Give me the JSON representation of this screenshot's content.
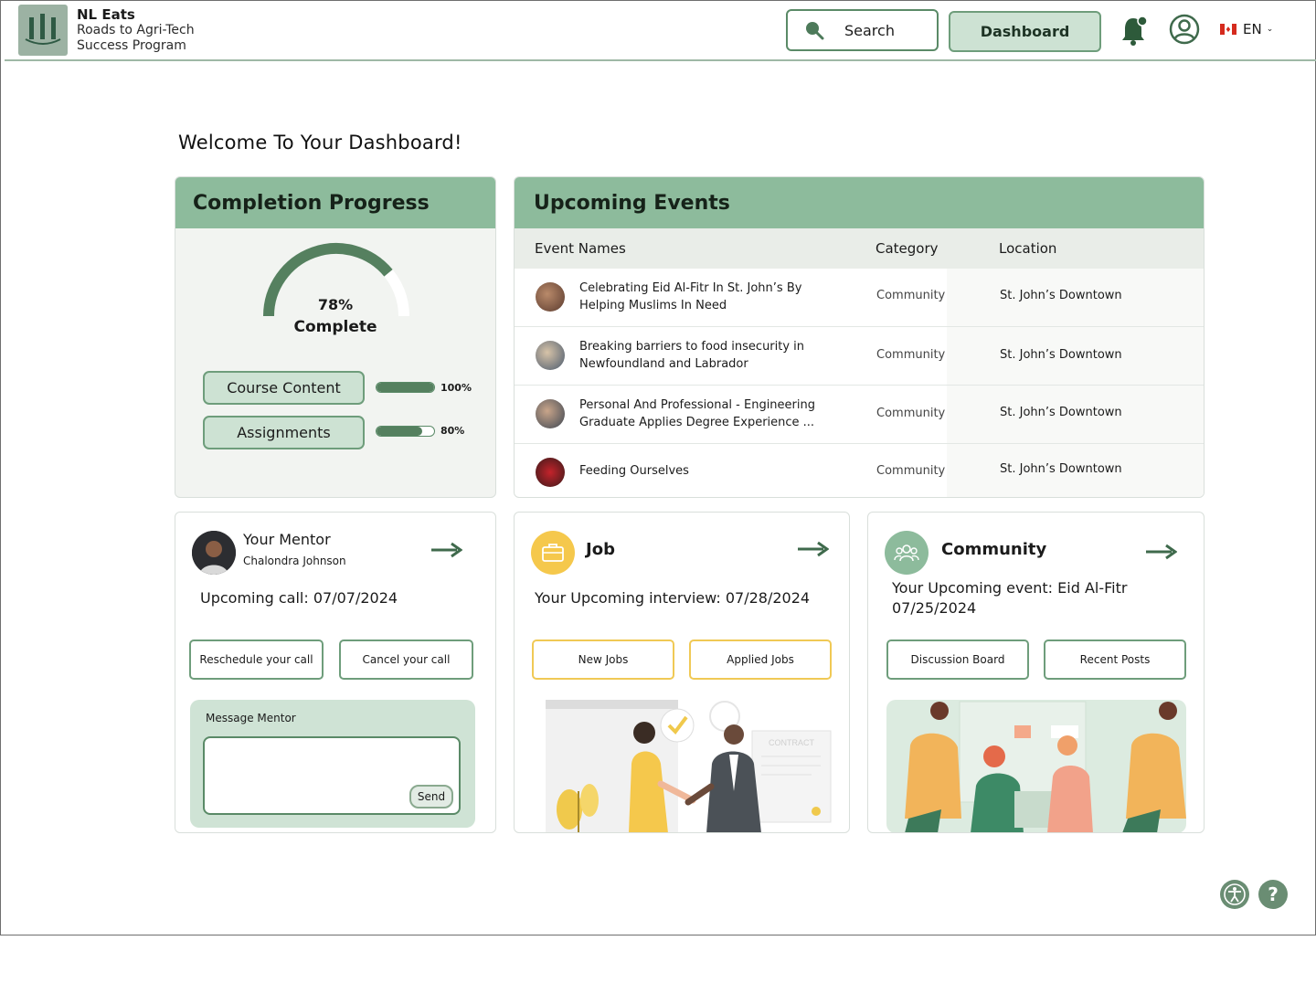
{
  "header": {
    "brand_name": "NL Eats",
    "brand_sub_line1": "Roads to Agri-Tech",
    "brand_sub_line2": "Success Program",
    "search_label": "Search",
    "dashboard_label": "Dashboard",
    "language": "EN",
    "icons": [
      "logo",
      "search-icon",
      "bell-icon",
      "user-icon",
      "canada-flag-icon",
      "chevron-down-icon"
    ]
  },
  "welcome": "Welcome To Your Dashboard!",
  "progress": {
    "title": "Completion Progress",
    "overall_pct": "78%",
    "overall_value": 0.78,
    "overall_label": "Complete",
    "items": [
      {
        "label": "Course Content",
        "pct": "100%",
        "value": 1.0
      },
      {
        "label": "Assignments",
        "pct": "80%",
        "value": 0.8
      }
    ]
  },
  "events": {
    "title": "Upcoming Events",
    "columns": [
      "Event Names",
      "Category",
      "Location"
    ],
    "rows": [
      {
        "name": "Celebrating Eid Al-Fitr In St. John’s By Helping Muslims In Need",
        "category": "Community",
        "location": "St. John’s Downtown"
      },
      {
        "name": "Breaking barriers to food insecurity in Newfoundland and Labrador",
        "category": "Community",
        "location": "St. John’s Downtown"
      },
      {
        "name": "Personal And Professional - Engineering Graduate Applies Degree Experience ...",
        "category": "Community",
        "location": "St. John’s Downtown"
      },
      {
        "name": "Feeding Ourselves",
        "category": "Community",
        "location": "St. John’s Downtown"
      }
    ]
  },
  "mentor": {
    "title": "Your Mentor",
    "name": "Chalondra Johnson",
    "upcoming": "Upcoming call: 07/07/2024",
    "reschedule": "Reschedule your call",
    "cancel": "Cancel your call",
    "message_label": "Message Mentor",
    "send": "Send"
  },
  "job": {
    "title": "Job",
    "upcoming": "Your Upcoming interview: 07/28/2024",
    "new_jobs": "New Jobs",
    "applied_jobs": "Applied Jobs",
    "illustration_text": "CONTRACT"
  },
  "community": {
    "title": "Community",
    "upcoming": "Your Upcoming event: Eid Al-Fitr 07/25/2024",
    "discussion": "Discussion Board",
    "recent": "Recent Posts"
  },
  "colors": {
    "accent_green": "#8dbb9c",
    "dark_green": "#55805f",
    "light_green": "#cde2d3",
    "yellow": "#f0c955"
  },
  "floating": {
    "help": "?"
  }
}
